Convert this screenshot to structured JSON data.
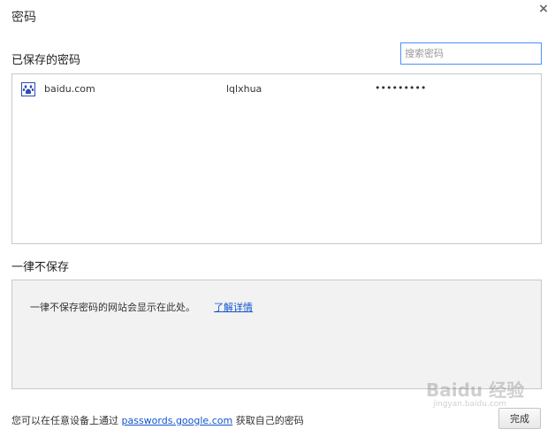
{
  "dialog": {
    "title": "密码",
    "close_glyph": "×"
  },
  "saved": {
    "title": "已保存的密码",
    "search_placeholder": "搜索密码",
    "rows": [
      {
        "site": "baidu.com",
        "username": "lqlxhua",
        "password": "•••••••••",
        "icon": "baidu-paw-icon"
      }
    ]
  },
  "never": {
    "title": "一律不保存",
    "empty_text": "一律不保存密码的网站会显示在此处。",
    "learn_more": "了解详情"
  },
  "footer": {
    "text_before": "您可以在任意设备上通过",
    "link": "passwords.google.com",
    "text_after": "获取自己的密码",
    "done_label": "完成"
  },
  "watermark": {
    "brand": "Baidu 经验",
    "url": "jingyan.baidu.com"
  },
  "colors": {
    "link": "#1155cc",
    "focus_border": "#4d90fe",
    "never_bg": "#f2f2f2",
    "icon_blue": "#2d4bb5"
  }
}
